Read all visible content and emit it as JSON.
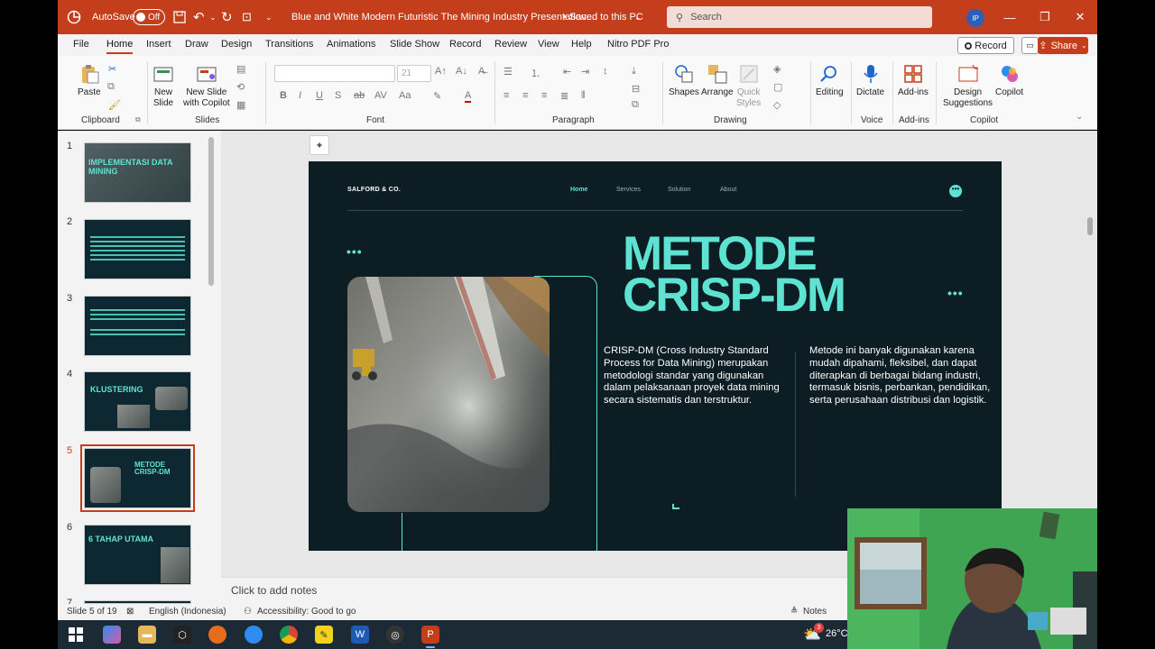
{
  "app": {
    "autosave_label": "AutoSave",
    "autosave_state": "Off",
    "document_title": "Blue and White Modern Futuristic The Mining Industry Presentation...",
    "save_status": "• Saved to this PC",
    "search_placeholder": "Search",
    "user_initials": "IP"
  },
  "menu": {
    "tabs": [
      "File",
      "Home",
      "Insert",
      "Draw",
      "Design",
      "Transitions",
      "Animations",
      "Slide Show",
      "Record",
      "Review",
      "View",
      "Help",
      "Nitro PDF Pro"
    ],
    "active_tab": "Home",
    "record_label": "Record",
    "share_label": "Share"
  },
  "ribbon": {
    "paste": "Paste",
    "new_slide": "New",
    "new_slide_2": "Slide",
    "new_slide_copilot": "New Slide",
    "new_slide_copilot_2": "with Copilot",
    "font_size": "21",
    "shapes": "Shapes",
    "arrange": "Arrange",
    "quick_styles": "Quick",
    "quick_styles_2": "Styles",
    "editing": "Editing",
    "dictate": "Dictate",
    "addins": "Add-ins",
    "designer": "Design",
    "designer_2": "Suggestions",
    "copilot": "Copilot",
    "groups": {
      "clipboard": "Clipboard",
      "slides": "Slides",
      "font": "Font",
      "paragraph": "Paragraph",
      "drawing": "Drawing",
      "voice": "Voice",
      "addins": "Add-ins",
      "copilot": "Copilot"
    }
  },
  "thumbnails": [
    {
      "number": "1",
      "title": "IMPLEMENTASI DATA MINING"
    },
    {
      "number": "2",
      "title": ""
    },
    {
      "number": "3",
      "title": ""
    },
    {
      "number": "4",
      "title": "KLUSTERING"
    },
    {
      "number": "5",
      "title": "METODE CRISP-DM"
    },
    {
      "number": "6",
      "title": "6 TAHAP UTAMA"
    },
    {
      "number": "7",
      "title": ""
    }
  ],
  "slide": {
    "brand": "SALFORD & CO.",
    "nav": [
      "Home",
      "Services",
      "Solution",
      "About"
    ],
    "menu_dots": "•••",
    "dots": "•••",
    "title_line1": "METODE",
    "title_line2": "CRISP-DM",
    "body_left": "CRISP-DM (Cross Industry Standard Process for Data Mining) merupakan metodologi standar yang digunakan dalam pelaksanaan proyek data mining secara sistematis dan terstruktur.",
    "body_right": "Metode ini banyak digunakan karena mudah dipahami, fleksibel, dan dapat diterapkan di berbagai bidang industri, termasuk bisnis, perbankan, pendidikan, serta perusahaan distribusi dan logistik."
  },
  "notes": {
    "placeholder": "Click to add notes"
  },
  "status": {
    "slide_info": "Slide 5 of 19",
    "language": "English (Indonesia)",
    "accessibility": "Accessibility: Good to go",
    "notes_button": "Notes"
  },
  "taskbar": {
    "temperature": "26°C",
    "badge": "3"
  },
  "colors": {
    "accent": "#c43e1c",
    "slide_bg": "#0d1d24",
    "teal": "#5ee3d2"
  }
}
